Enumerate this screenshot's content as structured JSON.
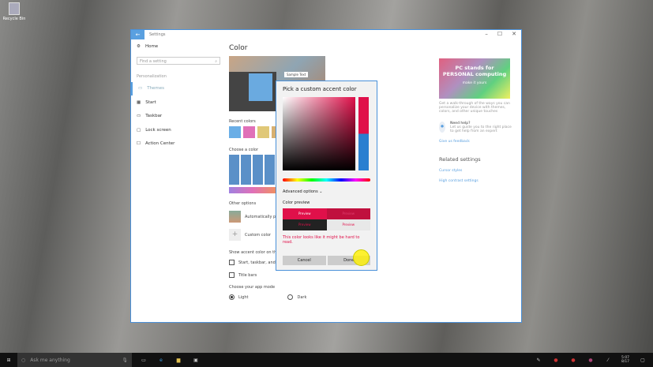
{
  "desktop": {
    "recycle_bin": "Recycle Bin"
  },
  "window": {
    "title": "Settings",
    "back": "←",
    "minimize": "–",
    "maximize": "☐",
    "close": "✕"
  },
  "sidebar": {
    "home": "Home",
    "search_placeholder": "Find a setting",
    "category": "Personalization",
    "items": [
      {
        "label": "Themes"
      },
      {
        "label": "Start"
      },
      {
        "label": "Taskbar"
      },
      {
        "label": "Lock screen"
      },
      {
        "label": "Action Center"
      }
    ]
  },
  "main": {
    "title": "Color",
    "sample_text": "Sample Text",
    "recent_colors": "Recent colors",
    "recent": [
      "#6aaee6",
      "#e070b8",
      "#e0c878",
      "#d8b070"
    ],
    "choose_color": "Choose a color",
    "other_options": "Other options",
    "auto_pick": "Automatically pick an accent color from my background",
    "custom_color": "Custom color",
    "show_accent": "Show accent color on the following surfaces",
    "start_taskbar": "Start, taskbar, and action center backgrounds",
    "title_bars": "Title bars",
    "app_mode": "Choose your app mode",
    "light": "Light",
    "dark": "Dark"
  },
  "right": {
    "promo_line1": "PC stands for",
    "promo_line2": "PERSONAL computing",
    "promo_sub": "make it yours",
    "promo_desc": "Get a walk-through of the ways you can personalize your device with themes, colors, and other unique touches",
    "need_help": "Need help?",
    "help_desc": "Let us guide you to the right place to get help from an expert",
    "feedback": "Give us feedback",
    "related": "Related settings",
    "cursor": "Cursor styles",
    "contrast": "High contrast settings"
  },
  "dialog": {
    "title": "Pick a custom accent color",
    "advanced": "Advanced options",
    "color_preview": "Color preview",
    "preview": "Preview",
    "warning": "This color looks like it might be hard to read.",
    "cancel": "Cancel",
    "done": "Done",
    "accent": "#e0104a"
  },
  "taskbar": {
    "search": "Ask me anything",
    "time": "5:07",
    "date": "8/17"
  }
}
